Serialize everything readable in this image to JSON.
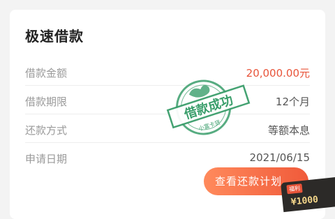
{
  "card": {
    "title": "极速借款",
    "rows": [
      {
        "label": "借款金额",
        "value": "20,000.00元"
      },
      {
        "label": "借款期限",
        "value": "12个月"
      },
      {
        "label": "还款方式",
        "value": "等额本息"
      },
      {
        "label": "申请日期",
        "value": "2021/06/15"
      }
    ],
    "button_label": "查看还款计划"
  },
  "stamp": {
    "main_text": "借款成功",
    "sub_text": "小富卡贷",
    "color": "#3a9e6b"
  },
  "badge": {
    "tag": "福利",
    "value": "¥1000"
  },
  "colors": {
    "amount": "#e8543a",
    "button_start": "#ff8a5c",
    "button_end": "#f05a3a"
  }
}
